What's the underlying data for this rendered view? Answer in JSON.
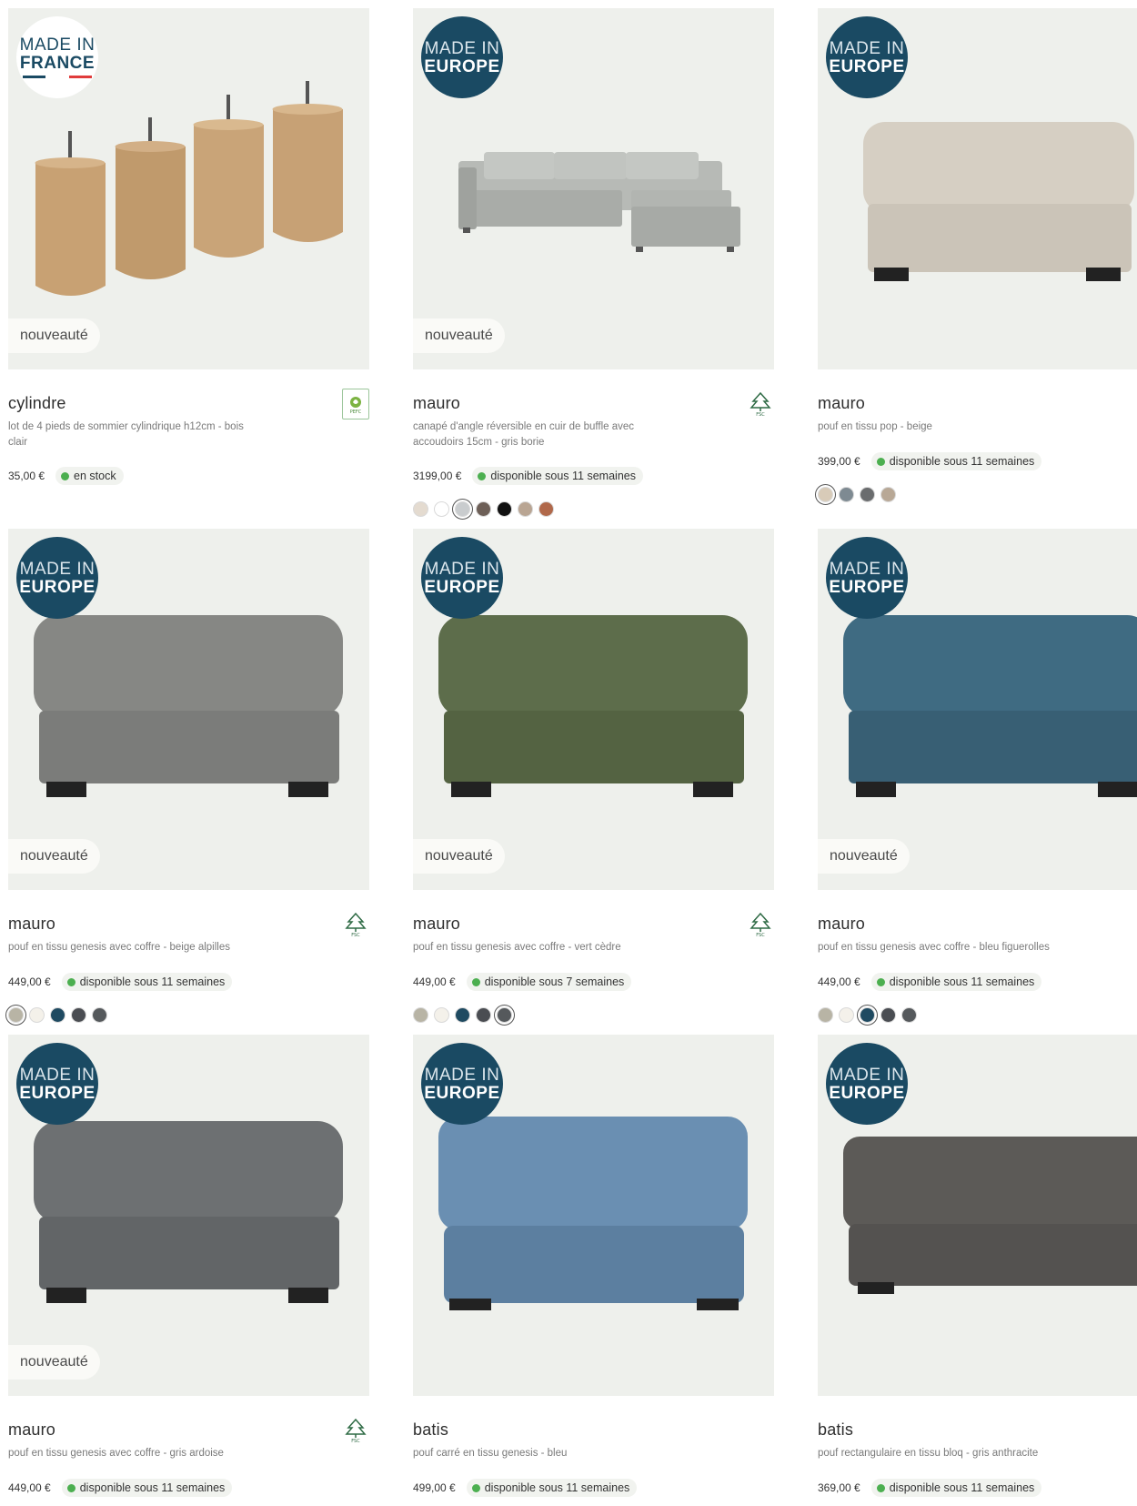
{
  "products": [
    {
      "badge_line1": "MADE IN",
      "badge_line2": "FRANCE",
      "tag": "nouveauté",
      "title": "cylindre",
      "desc": "lot de 4 pieds de sommier cylindrique h12cm - bois clair",
      "price": "35,00 €",
      "availability": "en stock",
      "cert": "PEFC",
      "swatches": []
    },
    {
      "badge_line1": "MADE IN",
      "badge_line2": "EUROPE",
      "tag": "nouveauté",
      "title": "mauro",
      "desc": "canapé d'angle réversible en cuir de buffle avec accoudoirs 15cm - gris borie",
      "price": "3199,00 €",
      "availability": "disponible sous 11 semaines",
      "cert": "FSC",
      "swatches": [
        "#e4dbd0",
        "#ffffff",
        "#c9ccce",
        "#6d5f57",
        "#111111",
        "#b9a593",
        "#b0684a"
      ]
    },
    {
      "badge_line1": "MADE IN",
      "badge_line2": "EUROPE",
      "tag": "",
      "title": "mauro",
      "desc": "pouf en tissu pop - beige",
      "price": "399,00 €",
      "availability": "disponible sous 11 semaines",
      "cert": "",
      "swatches": [
        "#d8cbb8",
        "#7e8a92",
        "#6a6c6e",
        "#b8a896"
      ]
    },
    {
      "badge_line1": "MADE IN",
      "badge_line2": "EUROPE",
      "tag": "nouveauté",
      "title": "mauro",
      "desc": "pouf en tissu genesis avec coffre - beige alpilles",
      "price": "449,00 €",
      "availability": "disponible sous 11 semaines",
      "cert": "FSC",
      "swatches": [
        "#b8b4a5",
        "#f4f1ea",
        "#1f4a61",
        "#4a4d52",
        "#55595c"
      ]
    },
    {
      "badge_line1": "MADE IN",
      "badge_line2": "EUROPE",
      "tag": "nouveauté",
      "title": "mauro",
      "desc": "pouf en tissu genesis avec coffre - vert cèdre",
      "price": "449,00 €",
      "availability": "disponible sous 7 semaines",
      "cert": "FSC",
      "swatches": [
        "#b8b4a5",
        "#f4f1ea",
        "#1f4a61",
        "#4a4d52",
        "#55595c"
      ]
    },
    {
      "badge_line1": "MADE IN",
      "badge_line2": "EUROPE",
      "tag": "nouveauté",
      "title": "mauro",
      "desc": "pouf en tissu genesis avec coffre - bleu figuerolles",
      "price": "449,00 €",
      "availability": "disponible sous 11 semaines",
      "cert": "",
      "swatches": [
        "#b8b4a5",
        "#f4f1ea",
        "#1f4a61",
        "#4a4d52",
        "#55595c"
      ]
    },
    {
      "badge_line1": "MADE IN",
      "badge_line2": "EUROPE",
      "tag": "nouveauté",
      "title": "mauro",
      "desc": "pouf en tissu genesis avec coffre - gris ardoise",
      "price": "449,00 €",
      "availability": "disponible sous 11 semaines",
      "cert": "FSC",
      "swatches": []
    },
    {
      "badge_line1": "MADE IN",
      "badge_line2": "EUROPE",
      "tag": "",
      "title": "batis",
      "desc": "pouf carré en tissu genesis - bleu",
      "price": "499,00 €",
      "availability": "disponible sous 11 semaines",
      "cert": "",
      "swatches": []
    },
    {
      "badge_line1": "MADE IN",
      "badge_line2": "EUROPE",
      "tag": "",
      "title": "batis",
      "desc": "pouf rectangulaire en tissu bloq - gris anthracite",
      "price": "369,00 €",
      "availability": "disponible sous 11 semaines",
      "cert": "",
      "swatches": []
    }
  ],
  "flag_colors": [
    "#1a4a63",
    "#ffffff",
    "#e03b3b"
  ],
  "fabric_colors": [
    "#b29066",
    "#9a9c9a",
    "#c8c0b2",
    "#7b7c7a",
    "#586948",
    "#3f6b82",
    "#6d7072",
    "#5d7da1",
    "#5c5a57"
  ]
}
